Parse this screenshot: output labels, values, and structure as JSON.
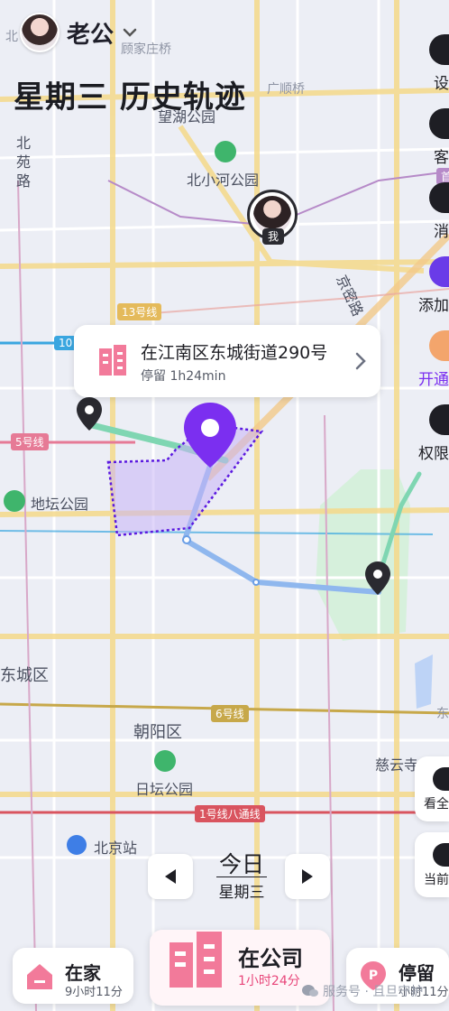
{
  "header": {
    "name": "老公",
    "title": "星期三 历史轨迹"
  },
  "right_menu": [
    {
      "label": "设",
      "icon": "gear-icon"
    },
    {
      "label": "客",
      "icon": "headset-icon"
    },
    {
      "label": "消",
      "icon": "message-icon"
    },
    {
      "label": "添加",
      "icon": "add-user-icon"
    },
    {
      "label": "开通",
      "icon": "crown-icon"
    },
    {
      "label": "权限",
      "icon": "shield-icon"
    }
  ],
  "map": {
    "labels": {
      "gulouzhuangqiao": "顾家庄桥",
      "guangshunqiao": "广顺桥",
      "wanghu_park": "望湖公园",
      "beiyuanlu_1": "北",
      "beiyuanlu_2": "苑",
      "beiyuanlu_3": "路",
      "beixiaohe_park": "北小河公园",
      "jingmi_road": "京密路",
      "ditan_park": "地坛公园",
      "dongcheng": "东城区",
      "chaoyang": "朝阳区",
      "ritan_park": "日坛公园",
      "ciyun_temple": "慈云寺",
      "beijing_station": "北京站",
      "bei_top": "北",
      "east_edge": "东"
    },
    "lines": {
      "line13": "13号线",
      "line10": "10",
      "line5": "5号线",
      "line6": "6号线",
      "line1": "1号线八通线",
      "shou": "首"
    },
    "me_marker": "我",
    "accent_color": "#7b2ff0"
  },
  "location_card": {
    "address": "在江南区东城街道290号",
    "stay_label": "停留",
    "stay_duration": "1h24min"
  },
  "side_buttons": {
    "view_all": "看全",
    "current": "当前"
  },
  "date_nav": {
    "day": "今日",
    "weekday": "星期三"
  },
  "bottom_tabs": {
    "home": {
      "name": "在家",
      "duration": "9小时11分"
    },
    "company": {
      "name": "在公司",
      "duration": "1小时24分"
    },
    "stay": {
      "name": "停留",
      "duration": "小时11分"
    }
  },
  "watermark": "服务号 · 且旦守护"
}
